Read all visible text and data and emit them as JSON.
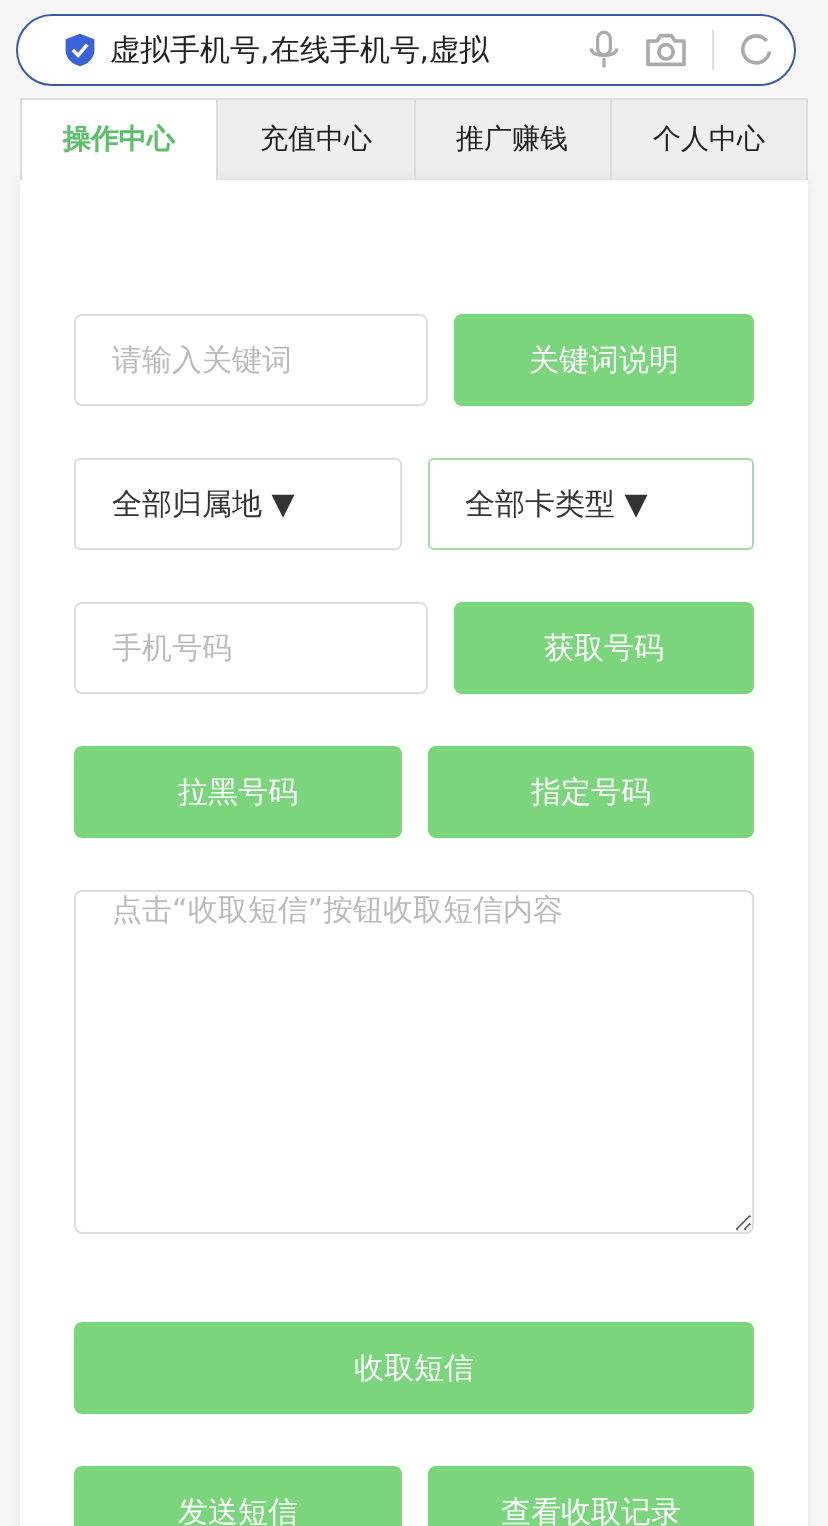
{
  "address_bar": {
    "value": "虚拟手机号,在线手机号,虚拟"
  },
  "tabs": [
    {
      "label": "操作中心",
      "selected": true
    },
    {
      "label": "充值中心",
      "selected": false
    },
    {
      "label": "推广赚钱",
      "selected": false
    },
    {
      "label": "个人中心",
      "selected": false
    }
  ],
  "rows": [
    [
      {
        "kind": "field",
        "placeholder": "请输入关键词"
      },
      {
        "kind": "button",
        "label": "关键词说明"
      }
    ],
    [
      {
        "kind": "select",
        "value": "全部归属地",
        "arrow": "▼",
        "focused": false
      },
      {
        "kind": "select",
        "value": "全部卡类型",
        "arrow": "▼",
        "focused": true
      }
    ],
    [
      {
        "kind": "field",
        "placeholder": "手机号码"
      },
      {
        "kind": "button",
        "label": "获取号码"
      }
    ],
    [
      {
        "kind": "button",
        "label": "拉黑号码"
      },
      {
        "kind": "button",
        "label": "指定号码"
      }
    ],
    [
      {
        "kind": "textarea",
        "placeholder": "点击“收取短信”按钮收取短信内容"
      }
    ],
    [
      {
        "kind": "button",
        "label": "收取短信"
      }
    ],
    [
      {
        "kind": "button",
        "label": "发送短信"
      },
      {
        "kind": "button",
        "label": "查看收取记录"
      }
    ]
  ]
}
